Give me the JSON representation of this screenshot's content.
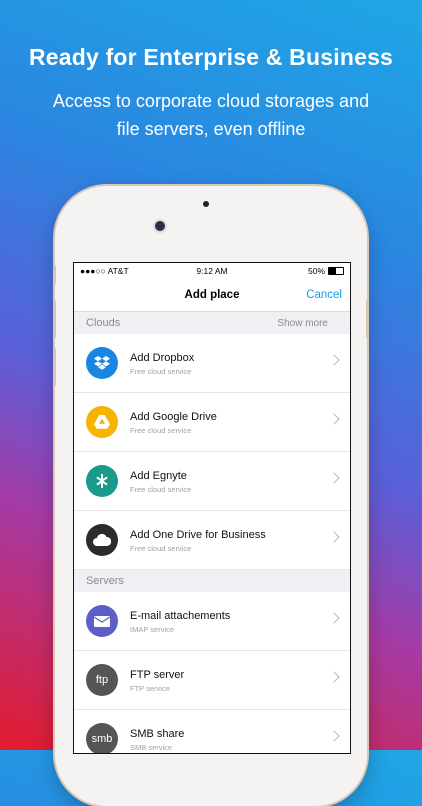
{
  "promo": {
    "headline": "Ready for Enterprise & Business",
    "subline": "Access to corporate cloud storages and file servers, even offline"
  },
  "status_bar": {
    "carrier": "●●●○○ AT&T",
    "time": "9:12 AM",
    "battery": "50%"
  },
  "nav": {
    "title": "Add place",
    "cancel": "Cancel"
  },
  "sections": {
    "clouds": {
      "label": "Clouds",
      "more": "Show more"
    },
    "servers": {
      "label": "Servers"
    }
  },
  "cloud_items": [
    {
      "name": "Add Dropbox",
      "sub": "Free cloud service",
      "icon": "dropbox-icon",
      "color": "#1a86e3"
    },
    {
      "name": "Add Google Drive",
      "sub": "Free cloud service",
      "icon": "google-drive-icon",
      "color": "#f4b400"
    },
    {
      "name": "Add Egnyte",
      "sub": "Free cloud service",
      "icon": "egnyte-icon",
      "color": "#1b9a8c"
    },
    {
      "name": "Add One Drive for Business",
      "sub": "Free cloud service",
      "icon": "onedrive-icon",
      "color": "#2b2b2b"
    }
  ],
  "server_items": [
    {
      "name": "E-mail attachements",
      "sub": "IMAP service",
      "icon": "mail-attachment-icon",
      "color": "#5b5fc7"
    },
    {
      "name": "FTP server",
      "sub": "FTP service",
      "icon": "ftp-icon",
      "color": "#555555",
      "icon_text": "ftp"
    },
    {
      "name": "SMB share",
      "sub": "SMB service",
      "icon": "smb-icon",
      "color": "#555555",
      "icon_text": "smb"
    }
  ]
}
